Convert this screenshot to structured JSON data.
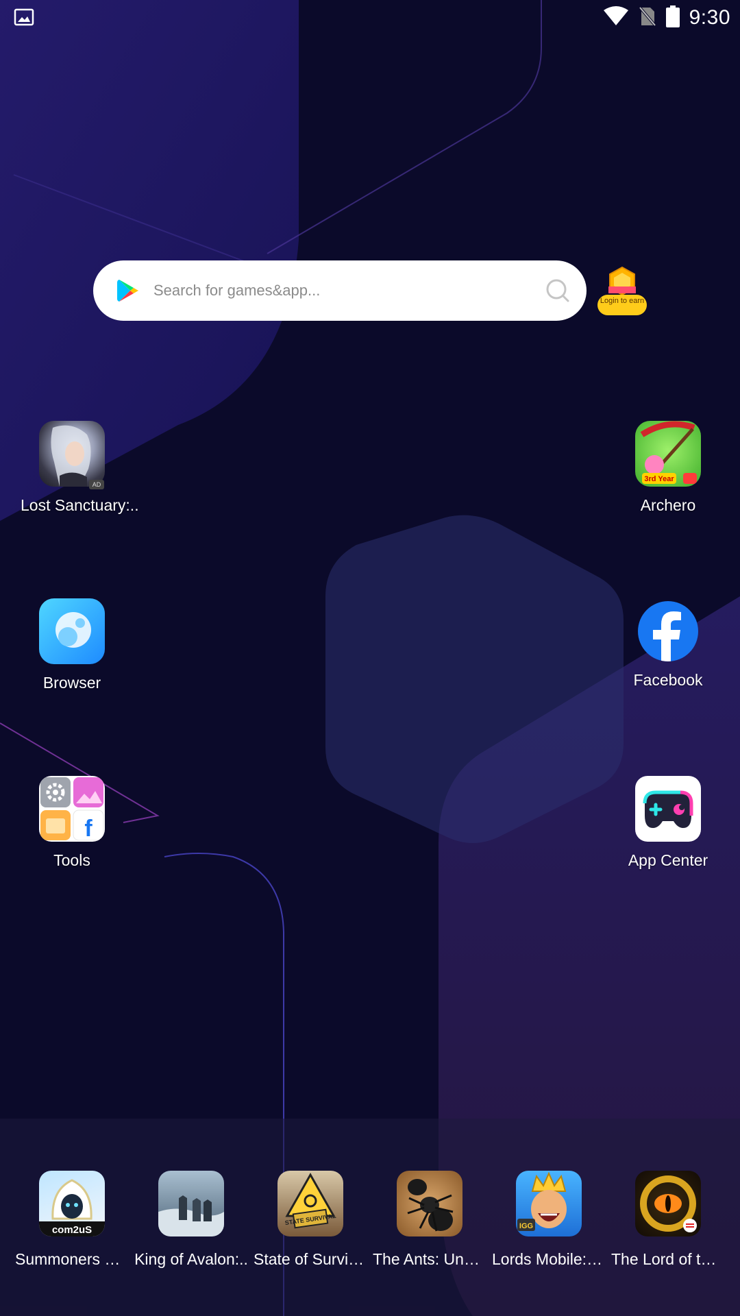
{
  "status_bar": {
    "time": "9:30",
    "icons": [
      "gallery-notification-icon",
      "wifi-icon",
      "no-sim-icon",
      "battery-icon"
    ]
  },
  "search": {
    "placeholder": "Search for games&app...",
    "badge_text": "Login to earn"
  },
  "apps": {
    "lost_sanctuary": {
      "label": "Lost Sanctuary:..",
      "badge": "AD"
    },
    "archero": {
      "label": "Archero",
      "badge": "3rd Year"
    },
    "browser": {
      "label": "Browser"
    },
    "facebook": {
      "label": "Facebook"
    },
    "tools": {
      "label": "Tools"
    },
    "app_center": {
      "label": "App Center"
    }
  },
  "dock": [
    {
      "label": "Summoners War",
      "icon_text": "com2uS"
    },
    {
      "label": "King of Avalon:.."
    },
    {
      "label": "State of Survival",
      "icon_text": "STATE SURVIVAL"
    },
    {
      "label": "The Ants: Unde.."
    },
    {
      "label": "Lords Mobile: T..",
      "icon_text": "IGG"
    },
    {
      "label": "The Lord of the.."
    }
  ],
  "colors": {
    "background": "#0c0a2c",
    "search_bg": "#ffffff",
    "badge_yellow": "#ffcc1a",
    "facebook_blue": "#1877f2"
  }
}
